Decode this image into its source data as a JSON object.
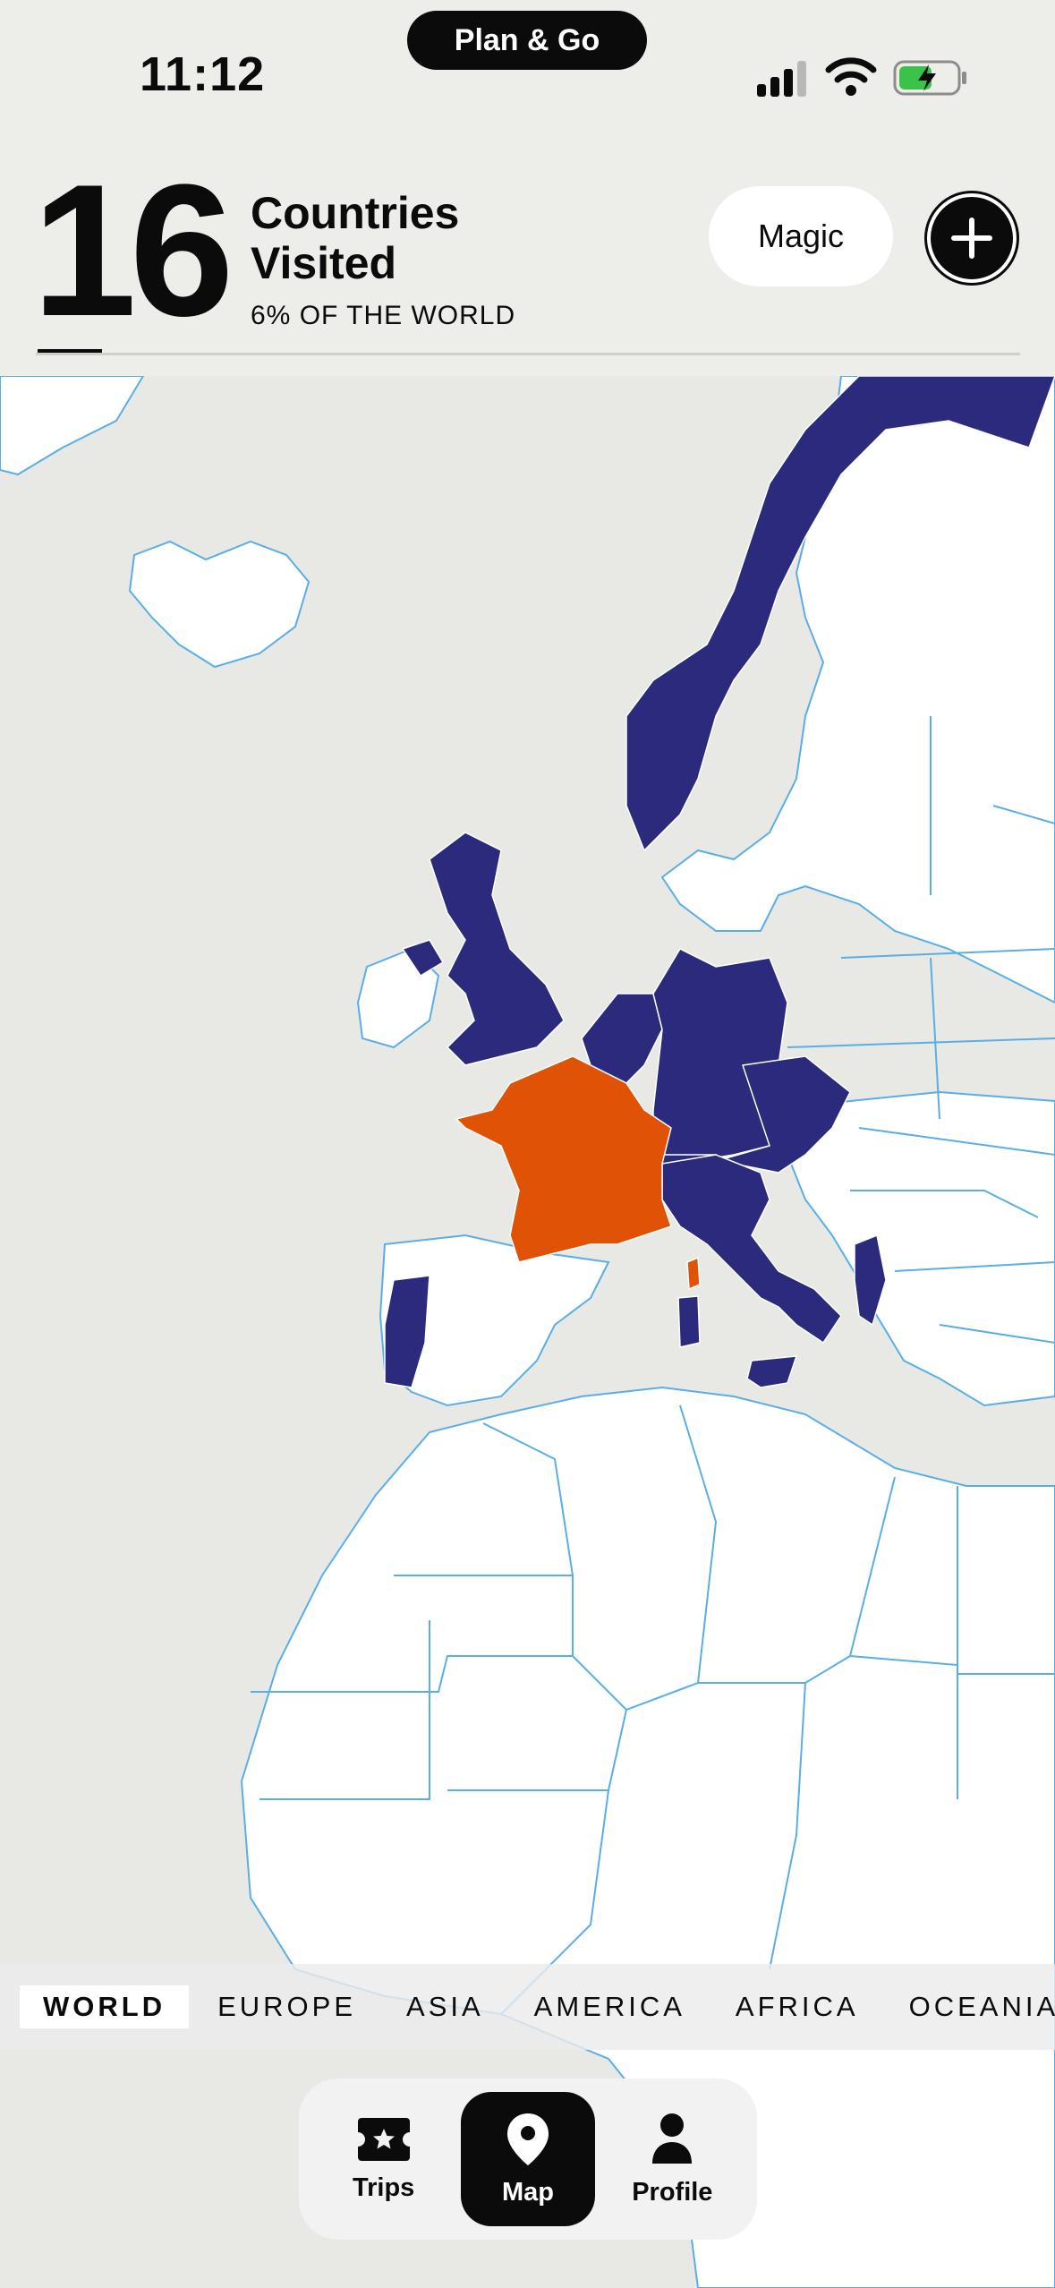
{
  "status_bar": {
    "time": "11:12",
    "app_pill": "Plan & Go",
    "icons": [
      "cellular-signal-icon",
      "wifi-icon",
      "battery-charging-icon"
    ]
  },
  "header": {
    "count": "16",
    "label_line1": "Countries",
    "label_line2": "Visited",
    "subtitle": "6% OF THE WORLD",
    "magic_label": "Magic",
    "add_icon": "plus-icon"
  },
  "map": {
    "visited_color": "#2b2a7c",
    "highlight_color": "#e05206",
    "land_color": "#ffffff",
    "border_color": "#5aaee6",
    "sea_color": "#e8e8e5"
  },
  "regions": [
    {
      "label": "WORLD",
      "active": true
    },
    {
      "label": "EUROPE",
      "active": false
    },
    {
      "label": "ASIA",
      "active": false
    },
    {
      "label": "AMERICA",
      "active": false
    },
    {
      "label": "AFRICA",
      "active": false
    },
    {
      "label": "OCEANIA",
      "active": false
    }
  ],
  "nav": {
    "trips": {
      "label": "Trips",
      "icon": "ticket-star-icon"
    },
    "map": {
      "label": "Map",
      "icon": "location-pin-icon",
      "active": true
    },
    "profile": {
      "label": "Profile",
      "icon": "person-icon"
    }
  }
}
